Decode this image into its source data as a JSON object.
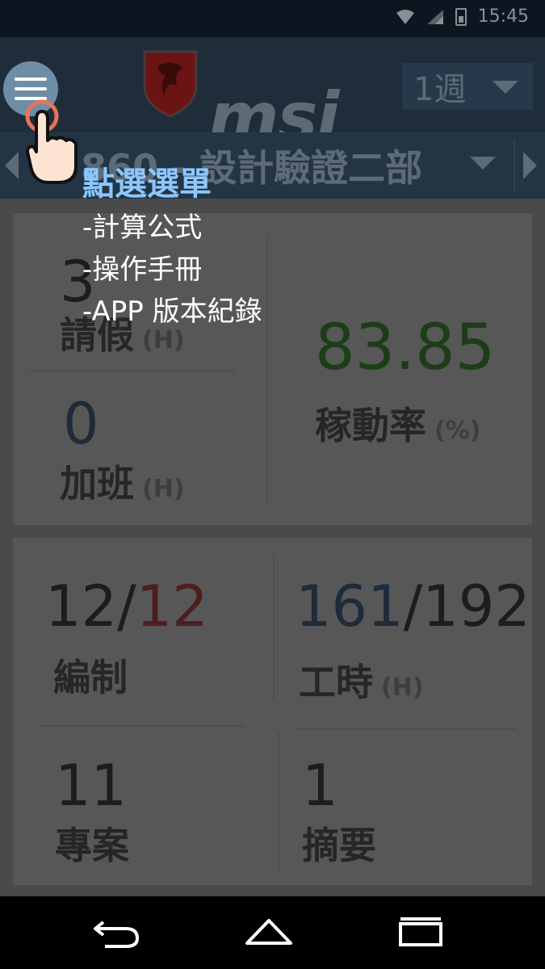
{
  "status_bar": {
    "time": "15:45"
  },
  "header": {
    "brand": "msi",
    "period": "1週",
    "department": "860 - 設計驗證二部"
  },
  "card1": {
    "leave": {
      "value": "3",
      "label": "請假",
      "unit": "(H)"
    },
    "overtime": {
      "value": "0",
      "label": "加班",
      "unit": "(H)"
    },
    "utilization": {
      "value": "83.85",
      "label": "稼動率",
      "unit": "(%)"
    }
  },
  "card2": {
    "staffing": {
      "value_actual": "12",
      "value_sep": "/",
      "value_total": "12",
      "label": "編制"
    },
    "hours": {
      "value_actual": "161",
      "value_sep": "/",
      "value_total": "192",
      "label": "工時",
      "unit": "(H)"
    },
    "projects": {
      "value": "11",
      "label": "專案"
    },
    "summary": {
      "value": "1",
      "label": "摘要"
    }
  },
  "tutorial": {
    "title": "點選選單",
    "items": [
      "-計算公式",
      "-操作手冊",
      "-APP 版本紀錄"
    ]
  },
  "colors": {
    "header_bg": "#1f2d3a",
    "value_blue": "#1d2b3a",
    "value_green": "#1c3d17",
    "value_red": "#4e1e1e",
    "tip_title": "#8cc8ff"
  }
}
